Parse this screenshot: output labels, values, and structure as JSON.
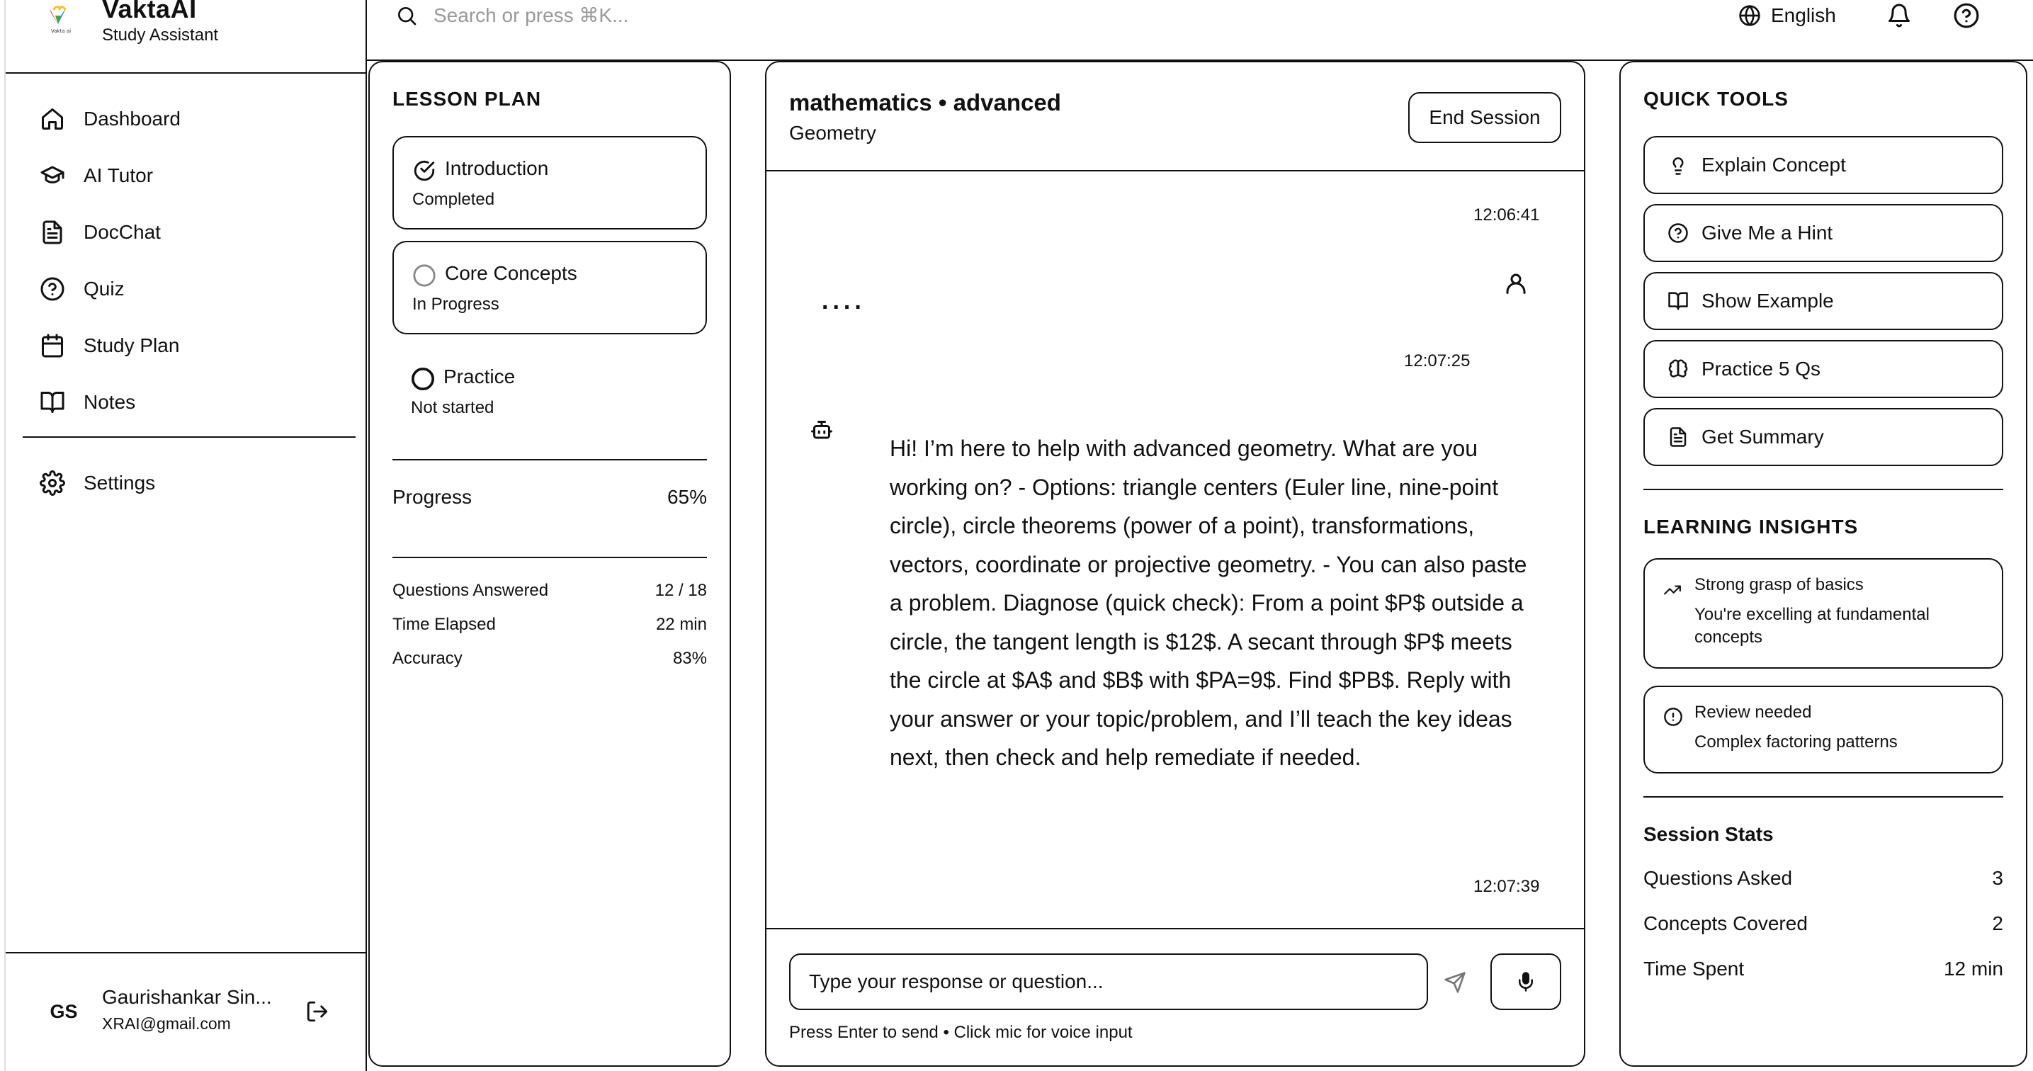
{
  "brand": {
    "name": "VaktaAI",
    "subtitle": "Study Assistant"
  },
  "nav": {
    "items": [
      {
        "label": "Dashboard",
        "icon": "home-icon"
      },
      {
        "label": "AI Tutor",
        "icon": "graduation-cap-icon"
      },
      {
        "label": "DocChat",
        "icon": "document-icon"
      },
      {
        "label": "Quiz",
        "icon": "help-circle-icon"
      },
      {
        "label": "Study Plan",
        "icon": "calendar-icon"
      },
      {
        "label": "Notes",
        "icon": "book-open-icon"
      }
    ],
    "settings": {
      "label": "Settings",
      "icon": "gear-icon"
    }
  },
  "user": {
    "initials": "GS",
    "name": "Gaurishankar Sin...",
    "email": "XRAI@gmail.com"
  },
  "topbar": {
    "search_placeholder": "Search or press ⌘K...",
    "language": "English"
  },
  "lesson_plan": {
    "title": "LESSON PLAN",
    "steps": [
      {
        "title": "Introduction",
        "status": "Completed",
        "icon": "check-circle-icon"
      },
      {
        "title": "Core Concepts",
        "status": "In Progress",
        "icon": "circle-icon"
      },
      {
        "title": "Practice",
        "status": "Not started",
        "icon": "circle-icon"
      }
    ],
    "progress": {
      "label": "Progress",
      "value": "65%"
    },
    "stats": [
      {
        "label": "Questions Answered",
        "value": "12 / 18"
      },
      {
        "label": "Time Elapsed",
        "value": "22 min"
      },
      {
        "label": "Accuracy",
        "value": "83%"
      }
    ]
  },
  "chat": {
    "subject": "mathematics • advanced",
    "topic": "Geometry",
    "end_session_label": "End Session",
    "messages": [
      {
        "role": "user",
        "time": "12:06:41",
        "text": "...."
      },
      {
        "role": "assistant",
        "time": "12:07:25",
        "text": "Hi! I’m here to help with advanced geometry. What are you working on? - Options: triangle centers (Euler line, nine-point circle), circle theorems (power of a point), transformations, vectors, coordinate or projective geometry. - You can also paste a problem. Diagnose (quick check): From a point $P$ outside a circle, the tangent length is $12$. A secant through $P$ meets the circle at $A$ and $B$ with $PA=9$. Find $PB$. Reply with your answer or your topic/problem, and I’ll teach the key ideas next, then check and help remediate if needed."
      }
    ],
    "last_time": "12:07:39",
    "input_placeholder": "Type your response or question...",
    "hint": "Press Enter to send • Click mic for voice input"
  },
  "quick_tools": {
    "title": "QUICK TOOLS",
    "items": [
      {
        "label": "Explain Concept",
        "icon": "lightbulb-icon"
      },
      {
        "label": "Give Me a Hint",
        "icon": "help-circle-icon"
      },
      {
        "label": "Show Example",
        "icon": "book-open-icon"
      },
      {
        "label": "Practice 5 Qs",
        "icon": "brain-icon"
      },
      {
        "label": "Get Summary",
        "icon": "document-icon"
      }
    ]
  },
  "insights": {
    "title": "LEARNING INSIGHTS",
    "items": [
      {
        "title": "Strong grasp of basics",
        "desc": "You're excelling at fundamental concepts",
        "icon": "trending-up-icon"
      },
      {
        "title": "Review needed",
        "desc": "Complex factoring patterns",
        "icon": "alert-circle-icon"
      }
    ]
  },
  "session_stats": {
    "title": "Session Stats",
    "rows": [
      {
        "label": "Questions Asked",
        "value": "3"
      },
      {
        "label": "Concepts Covered",
        "value": "2"
      },
      {
        "label": "Time Spent",
        "value": "12 min"
      }
    ]
  }
}
